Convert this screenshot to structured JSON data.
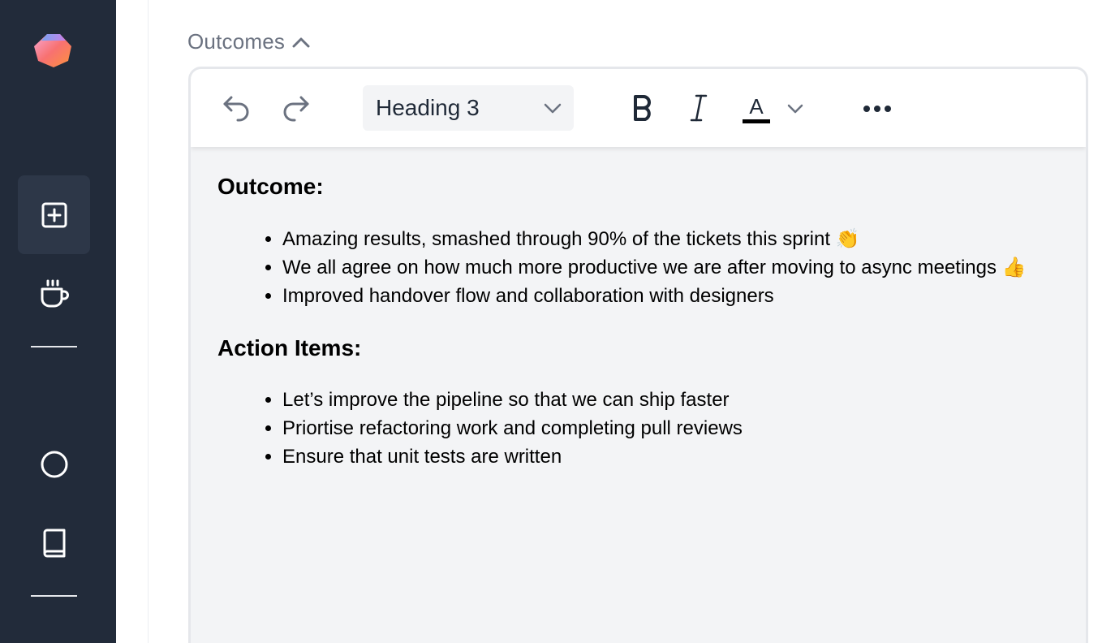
{
  "section": {
    "title": "Outcomes"
  },
  "toolbar": {
    "block_style": "Heading 3",
    "text_color": "#000000"
  },
  "editor": {
    "outcome_heading": "Outcome:",
    "outcome_items": [
      "Amazing results, smashed through 90% of the tickets this sprint 👏",
      "We all agree on how much more productive we are after moving to async meetings 👍",
      "Improved handover flow and collaboration with designers"
    ],
    "action_heading": "Action Items:",
    "action_items": [
      "Let’s improve the pipeline so that we can ship faster",
      "Priortise refactoring work and completing pull reviews",
      "Ensure that unit tests are written"
    ]
  },
  "colors": {
    "sidebar_bg": "#222b3a",
    "editor_bg": "#f3f4f6"
  }
}
